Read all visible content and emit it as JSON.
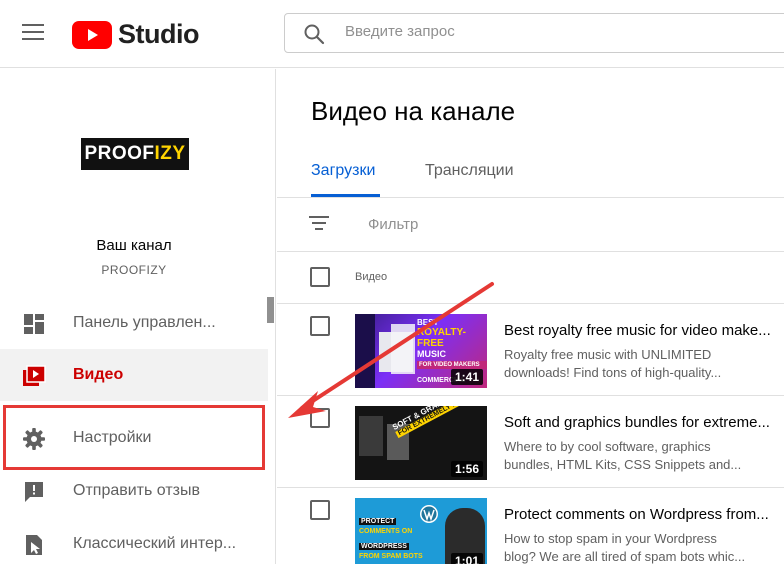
{
  "header": {
    "brand": "Studio",
    "search_placeholder": "Введите запрос"
  },
  "sidebar": {
    "channel_logo_part1": "PROOF",
    "channel_logo_part2": "IZY",
    "channel_title": "Ваш канал",
    "channel_handle": "PROOFIZY",
    "items": [
      {
        "label": "Панель управлен...",
        "icon": "dashboard-icon",
        "active": false
      },
      {
        "label": "Видео",
        "icon": "video-icon",
        "active": true
      },
      {
        "label": "Настройки",
        "icon": "gear-icon",
        "active": false
      },
      {
        "label": "Отправить отзыв",
        "icon": "feedback-icon",
        "active": false
      },
      {
        "label": "Классический интер...",
        "icon": "classic-icon",
        "active": false
      }
    ]
  },
  "main": {
    "title": "Видео на канале",
    "tabs": [
      {
        "label": "Загрузки",
        "active": true
      },
      {
        "label": "Трансляции",
        "active": false
      }
    ],
    "filter_label": "Фильтр",
    "column_video": "Видео",
    "videos": [
      {
        "title": "Best royalty free music for video make...",
        "desc1": "Royalty free music with UNLIMITED",
        "desc2": "downloads! Find tons of high-quality...",
        "duration": "1:41",
        "thumb_lines": [
          "BEST",
          "ROYALTY-FREE",
          "MUSIC",
          "FOR VIDEO MAKERS",
          "COMMERCIAL"
        ]
      },
      {
        "title": "Soft and graphics bundles for extreme...",
        "desc1": "Where to by cool software, graphics",
        "desc2": "bundles, HTML Kits, CSS Snippets and...",
        "duration": "1:56",
        "thumb_lines": [
          "SOFT & GRAPHIC BUNDLES",
          "FOR EXTREMELY LOW PRICES!"
        ]
      },
      {
        "title": "Protect comments on Wordpress from...",
        "desc1": "How to stop spam in your Wordpress",
        "desc2": "blog? We are all tired of spam bots whic...",
        "duration": "1:01",
        "thumb_lines": [
          "PROTECT",
          "COMMENTS ON",
          "WORDPRESS",
          "FROM SPAM BOTS"
        ]
      }
    ]
  },
  "colors": {
    "accent_blue": "#065fd4",
    "active_red": "#cc0000",
    "youtube_red": "#ff0000",
    "annotation_red": "#e53935"
  }
}
